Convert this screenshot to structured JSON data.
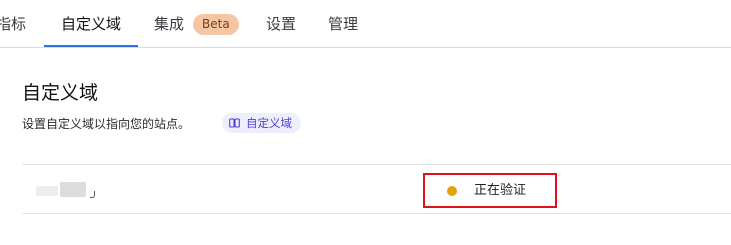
{
  "tabs": [
    {
      "label": "指标"
    },
    {
      "label": "自定义域"
    },
    {
      "label": "集成",
      "badge": "Beta"
    },
    {
      "label": "设置"
    },
    {
      "label": "管理"
    }
  ],
  "active_tab": "自定义域",
  "section": {
    "title": "自定义域",
    "description": "设置自定义域以指向您的站点。",
    "docs_chip": "自定义域"
  },
  "domains": [
    {
      "name_masked": true,
      "status": "正在验证",
      "status_color": "#e3a20f"
    }
  ],
  "colors": {
    "accent": "#2f6fe8",
    "badge_bg": "#f4c6a3",
    "chip_bg": "#efeefc",
    "chip_text": "#4b3fd6",
    "highlight_box": "#e0101d"
  }
}
